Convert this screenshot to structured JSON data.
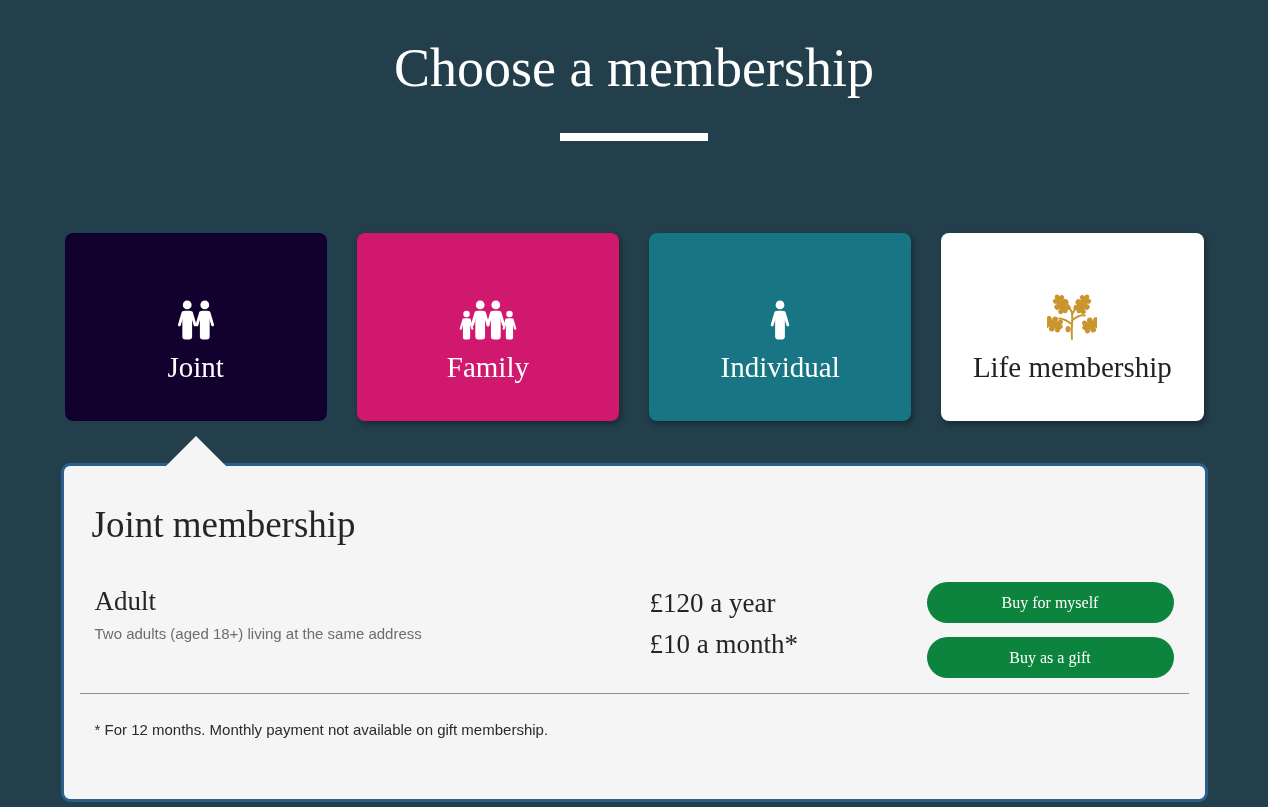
{
  "heading": {
    "title": "Choose a membership"
  },
  "membership_types": [
    {
      "label": "Joint",
      "kind": "couple",
      "color": "#12002f",
      "selected": true
    },
    {
      "label": "Family",
      "kind": "family",
      "color": "#d0186e",
      "selected": false
    },
    {
      "label": "Individual",
      "kind": "single",
      "color": "#177584",
      "selected": false
    },
    {
      "label": "Life membership",
      "kind": "oak",
      "color": "#ffffff",
      "selected": false
    }
  ],
  "details": {
    "title": "Joint membership",
    "options": [
      {
        "name": "Adult",
        "description": "Two adults (aged 18+) living at the same address",
        "prices": [
          "£120 a year",
          "£10 a month*"
        ],
        "buttons": [
          "Buy for myself",
          "Buy as a gift"
        ]
      }
    ],
    "footnote": "* For 12 months. Monthly payment not available on gift membership."
  }
}
